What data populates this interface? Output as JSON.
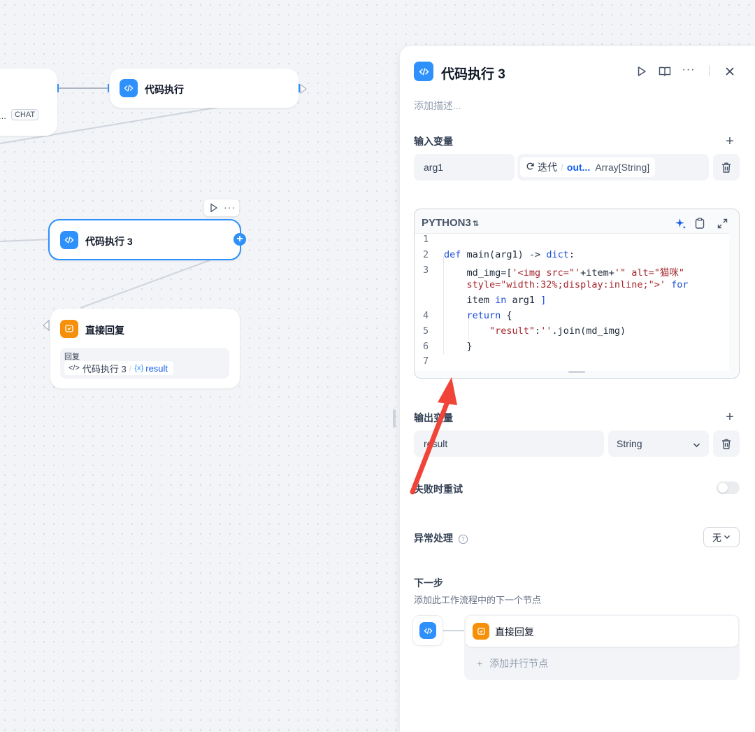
{
  "canvas": {
    "top_node": {
      "badge": "CHAT",
      "ellipsis": "..."
    },
    "code_node": {
      "title": "代码执行"
    },
    "code_node3": {
      "title": "代码执行 3"
    },
    "reply_node": {
      "title": "直接回复",
      "section_label": "回复",
      "ref_node": "代码执行 3",
      "ref_var": "result",
      "var_icon": "{x}"
    }
  },
  "panel": {
    "title": "代码执行 3",
    "description_placeholder": "添加描述...",
    "input": {
      "label": "输入变量",
      "var_name": "arg1",
      "source_node": "迭代",
      "source_var": "out...",
      "source_type": "Array[String]"
    },
    "code": {
      "language": "PYTHON3",
      "lines": [
        {
          "n": "1",
          "parts": []
        },
        {
          "n": "2",
          "parts": [
            [
              "kw",
              "def "
            ],
            [
              "pl",
              "main(arg1) -> "
            ],
            [
              "kw",
              "dict"
            ],
            [
              "pl",
              ":"
            ]
          ]
        },
        {
          "n": "3",
          "parts": [
            [
              "pl",
              "    md_img=["
            ],
            [
              "st",
              "'<img src=\"'"
            ],
            [
              "pl",
              "+item+"
            ],
            [
              "st",
              "'\" alt=\"猫咪\""
            ]
          ]
        },
        {
          "n": "",
          "parts": [
            [
              "st",
              "    style=\"width:32%;display:inline;\">'"
            ],
            [
              "kw",
              " for"
            ]
          ]
        },
        {
          "n": "",
          "parts": [
            [
              "pl",
              "    item "
            ],
            [
              "kw",
              "in"
            ],
            [
              "pl",
              " arg1 "
            ],
            [
              "kw",
              "]"
            ]
          ]
        },
        {
          "n": "4",
          "parts": [
            [
              "kw",
              "    return"
            ],
            [
              "pl",
              " {"
            ]
          ]
        },
        {
          "n": "5",
          "parts": [
            [
              "st",
              "        \"result\""
            ],
            [
              "pl",
              ":"
            ],
            [
              "st",
              "''"
            ],
            [
              "pl",
              ".join(md_img)"
            ]
          ]
        },
        {
          "n": "6",
          "parts": [
            [
              "pl",
              "    }"
            ]
          ]
        },
        {
          "n": "7",
          "parts": []
        }
      ]
    },
    "output": {
      "label": "输出变量",
      "var_name": "result",
      "type": "String"
    },
    "retry": {
      "label": "失败时重试",
      "enabled": false
    },
    "error": {
      "label": "异常处理",
      "value": "无"
    },
    "next": {
      "label": "下一步",
      "hint": "添加此工作流程中的下一个节点",
      "next_node": "直接回复",
      "add_parallel": "添加并行节点"
    }
  },
  "colors": {
    "accent": "#2e90fa",
    "arrow": "#f04438",
    "orange": "#f79009"
  }
}
